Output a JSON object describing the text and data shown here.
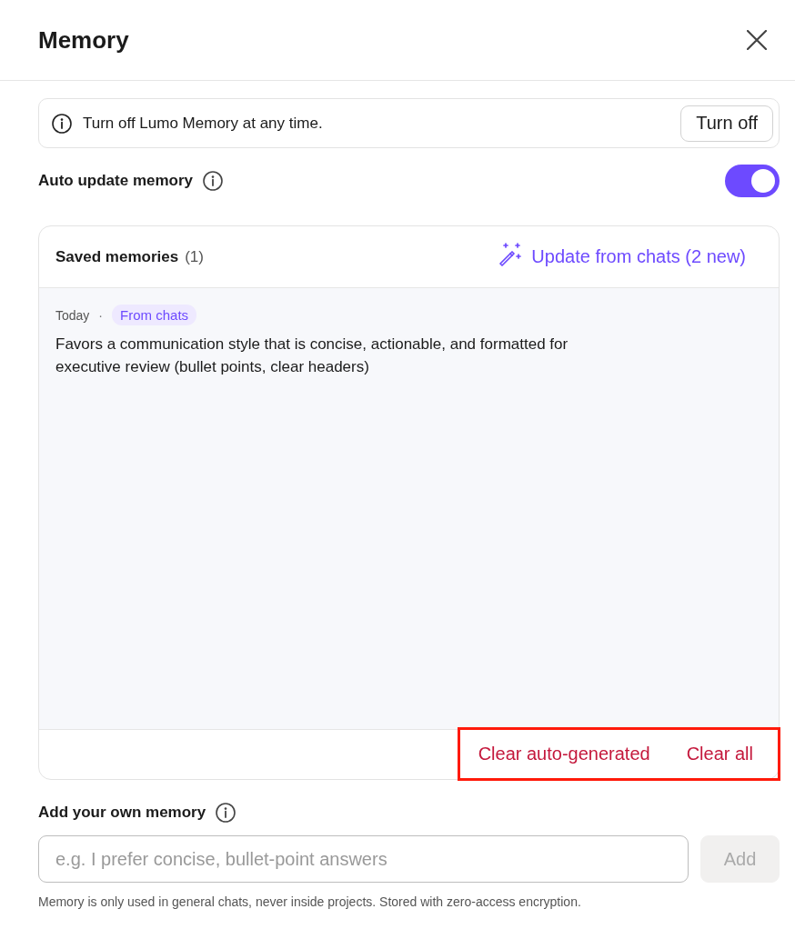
{
  "dialog": {
    "title": "Memory"
  },
  "notice": {
    "text": "Turn off Lumo Memory at any time.",
    "button": "Turn off"
  },
  "auto_update": {
    "label": "Auto update memory",
    "on": true
  },
  "saved_memories": {
    "title": "Saved memories",
    "count": "(1)",
    "update_button": "Update from chats (2 new)",
    "items": [
      {
        "date": "Today",
        "separator": "·",
        "tag": "From chats",
        "text": "Favors a communication style that is concise, actionable, and formatted for executive review (bullet points, clear headers)"
      }
    ],
    "actions": {
      "highlighted": true,
      "buttons": [
        "Clear auto-generated",
        "Clear all"
      ]
    }
  },
  "add_memory": {
    "label": "Add your own memory",
    "placeholder": "e.g. I prefer concise, bullet-point answers",
    "button": "Add",
    "button_disabled": true
  },
  "footnote": "Memory is only used in general chats, never inside projects. Stored with zero-access encryption."
}
